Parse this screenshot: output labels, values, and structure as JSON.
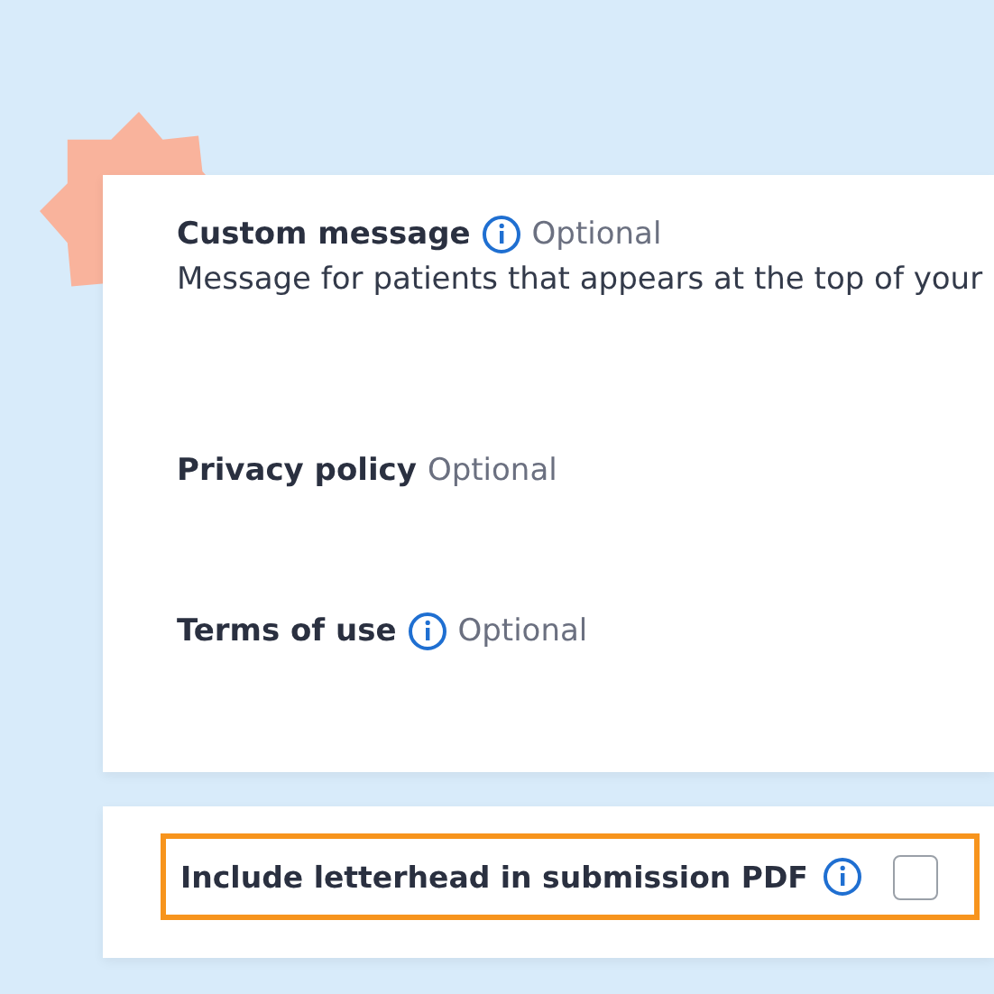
{
  "fields": [
    {
      "label": "Custom message",
      "info_icon": true,
      "tag": "Optional",
      "description": "Message for patients that appears at the top of your"
    },
    {
      "label": "Privacy policy",
      "info_icon": false,
      "tag": "Optional"
    },
    {
      "label": "Terms of use",
      "info_icon": true,
      "tag": "Optional"
    }
  ],
  "letterhead_option": {
    "label": "Include letterhead in submission PDF",
    "info_icon": true,
    "checked": false,
    "highlighted": true
  }
}
